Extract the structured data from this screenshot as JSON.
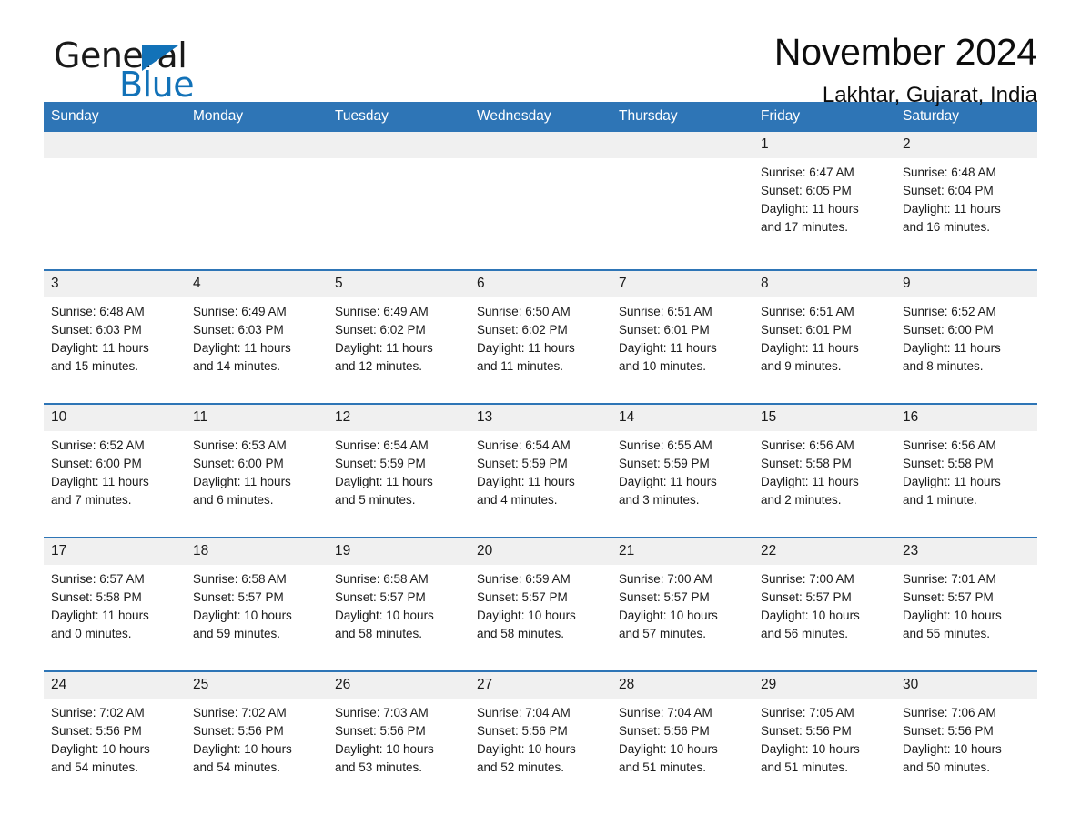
{
  "logo": {
    "word1": "General",
    "word2": "Blue",
    "triangle_color": "#1272b8",
    "icon": "triangle-icon"
  },
  "header": {
    "title": "November 2024",
    "subtitle": "Lakhtar, Gujarat, India"
  },
  "theme": {
    "header_blue": "#2e75b6",
    "daynum_bg": "#f0f0f0",
    "text": "#1a1a1a"
  },
  "calendar": {
    "weekday_headers": [
      "Sunday",
      "Monday",
      "Tuesday",
      "Wednesday",
      "Thursday",
      "Friday",
      "Saturday"
    ],
    "weeks": [
      [
        {
          "day": "",
          "lines": []
        },
        {
          "day": "",
          "lines": []
        },
        {
          "day": "",
          "lines": []
        },
        {
          "day": "",
          "lines": []
        },
        {
          "day": "",
          "lines": []
        },
        {
          "day": "1",
          "lines": [
            "Sunrise: 6:47 AM",
            "Sunset: 6:05 PM",
            "Daylight: 11 hours",
            "and 17 minutes."
          ]
        },
        {
          "day": "2",
          "lines": [
            "Sunrise: 6:48 AM",
            "Sunset: 6:04 PM",
            "Daylight: 11 hours",
            "and 16 minutes."
          ]
        }
      ],
      [
        {
          "day": "3",
          "lines": [
            "Sunrise: 6:48 AM",
            "Sunset: 6:03 PM",
            "Daylight: 11 hours",
            "and 15 minutes."
          ]
        },
        {
          "day": "4",
          "lines": [
            "Sunrise: 6:49 AM",
            "Sunset: 6:03 PM",
            "Daylight: 11 hours",
            "and 14 minutes."
          ]
        },
        {
          "day": "5",
          "lines": [
            "Sunrise: 6:49 AM",
            "Sunset: 6:02 PM",
            "Daylight: 11 hours",
            "and 12 minutes."
          ]
        },
        {
          "day": "6",
          "lines": [
            "Sunrise: 6:50 AM",
            "Sunset: 6:02 PM",
            "Daylight: 11 hours",
            "and 11 minutes."
          ]
        },
        {
          "day": "7",
          "lines": [
            "Sunrise: 6:51 AM",
            "Sunset: 6:01 PM",
            "Daylight: 11 hours",
            "and 10 minutes."
          ]
        },
        {
          "day": "8",
          "lines": [
            "Sunrise: 6:51 AM",
            "Sunset: 6:01 PM",
            "Daylight: 11 hours",
            "and 9 minutes."
          ]
        },
        {
          "day": "9",
          "lines": [
            "Sunrise: 6:52 AM",
            "Sunset: 6:00 PM",
            "Daylight: 11 hours",
            "and 8 minutes."
          ]
        }
      ],
      [
        {
          "day": "10",
          "lines": [
            "Sunrise: 6:52 AM",
            "Sunset: 6:00 PM",
            "Daylight: 11 hours",
            "and 7 minutes."
          ]
        },
        {
          "day": "11",
          "lines": [
            "Sunrise: 6:53 AM",
            "Sunset: 6:00 PM",
            "Daylight: 11 hours",
            "and 6 minutes."
          ]
        },
        {
          "day": "12",
          "lines": [
            "Sunrise: 6:54 AM",
            "Sunset: 5:59 PM",
            "Daylight: 11 hours",
            "and 5 minutes."
          ]
        },
        {
          "day": "13",
          "lines": [
            "Sunrise: 6:54 AM",
            "Sunset: 5:59 PM",
            "Daylight: 11 hours",
            "and 4 minutes."
          ]
        },
        {
          "day": "14",
          "lines": [
            "Sunrise: 6:55 AM",
            "Sunset: 5:59 PM",
            "Daylight: 11 hours",
            "and 3 minutes."
          ]
        },
        {
          "day": "15",
          "lines": [
            "Sunrise: 6:56 AM",
            "Sunset: 5:58 PM",
            "Daylight: 11 hours",
            "and 2 minutes."
          ]
        },
        {
          "day": "16",
          "lines": [
            "Sunrise: 6:56 AM",
            "Sunset: 5:58 PM",
            "Daylight: 11 hours",
            "and 1 minute."
          ]
        }
      ],
      [
        {
          "day": "17",
          "lines": [
            "Sunrise: 6:57 AM",
            "Sunset: 5:58 PM",
            "Daylight: 11 hours",
            "and 0 minutes."
          ]
        },
        {
          "day": "18",
          "lines": [
            "Sunrise: 6:58 AM",
            "Sunset: 5:57 PM",
            "Daylight: 10 hours",
            "and 59 minutes."
          ]
        },
        {
          "day": "19",
          "lines": [
            "Sunrise: 6:58 AM",
            "Sunset: 5:57 PM",
            "Daylight: 10 hours",
            "and 58 minutes."
          ]
        },
        {
          "day": "20",
          "lines": [
            "Sunrise: 6:59 AM",
            "Sunset: 5:57 PM",
            "Daylight: 10 hours",
            "and 58 minutes."
          ]
        },
        {
          "day": "21",
          "lines": [
            "Sunrise: 7:00 AM",
            "Sunset: 5:57 PM",
            "Daylight: 10 hours",
            "and 57 minutes."
          ]
        },
        {
          "day": "22",
          "lines": [
            "Sunrise: 7:00 AM",
            "Sunset: 5:57 PM",
            "Daylight: 10 hours",
            "and 56 minutes."
          ]
        },
        {
          "day": "23",
          "lines": [
            "Sunrise: 7:01 AM",
            "Sunset: 5:57 PM",
            "Daylight: 10 hours",
            "and 55 minutes."
          ]
        }
      ],
      [
        {
          "day": "24",
          "lines": [
            "Sunrise: 7:02 AM",
            "Sunset: 5:56 PM",
            "Daylight: 10 hours",
            "and 54 minutes."
          ]
        },
        {
          "day": "25",
          "lines": [
            "Sunrise: 7:02 AM",
            "Sunset: 5:56 PM",
            "Daylight: 10 hours",
            "and 54 minutes."
          ]
        },
        {
          "day": "26",
          "lines": [
            "Sunrise: 7:03 AM",
            "Sunset: 5:56 PM",
            "Daylight: 10 hours",
            "and 53 minutes."
          ]
        },
        {
          "day": "27",
          "lines": [
            "Sunrise: 7:04 AM",
            "Sunset: 5:56 PM",
            "Daylight: 10 hours",
            "and 52 minutes."
          ]
        },
        {
          "day": "28",
          "lines": [
            "Sunrise: 7:04 AM",
            "Sunset: 5:56 PM",
            "Daylight: 10 hours",
            "and 51 minutes."
          ]
        },
        {
          "day": "29",
          "lines": [
            "Sunrise: 7:05 AM",
            "Sunset: 5:56 PM",
            "Daylight: 10 hours",
            "and 51 minutes."
          ]
        },
        {
          "day": "30",
          "lines": [
            "Sunrise: 7:06 AM",
            "Sunset: 5:56 PM",
            "Daylight: 10 hours",
            "and 50 minutes."
          ]
        }
      ]
    ]
  }
}
